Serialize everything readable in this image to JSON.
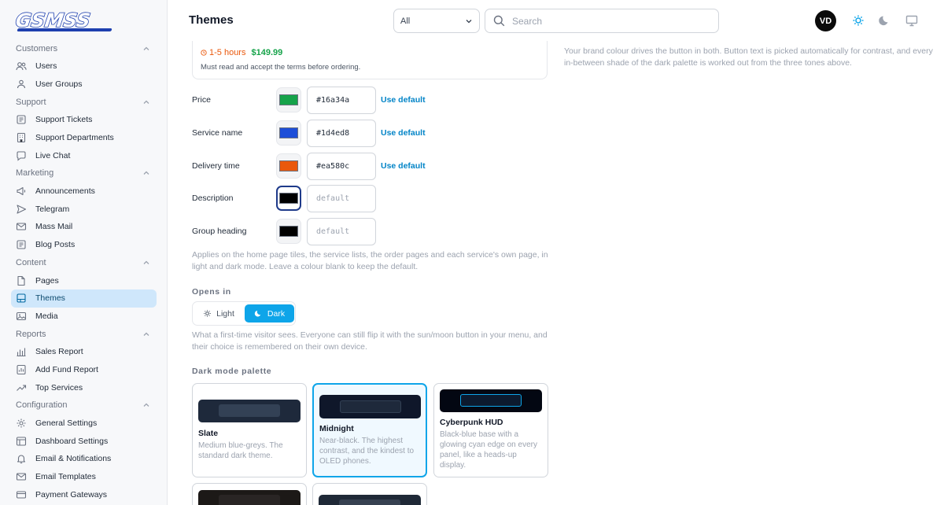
{
  "brand": {
    "logo_text": "GSMSS"
  },
  "header": {
    "title": "Themes",
    "filter_value": "All",
    "search_placeholder": "Search",
    "avatar_initials": "VD"
  },
  "sidebar": {
    "sections": [
      {
        "label": "Customers",
        "items": [
          {
            "label": "Users",
            "icon": "users-icon"
          },
          {
            "label": "User Groups",
            "icon": "user-group-icon"
          }
        ]
      },
      {
        "label": "Support",
        "items": [
          {
            "label": "Support Tickets",
            "icon": "ticket-icon"
          },
          {
            "label": "Support Departments",
            "icon": "building-icon"
          },
          {
            "label": "Live Chat",
            "icon": "chat-icon"
          }
        ]
      },
      {
        "label": "Marketing",
        "items": [
          {
            "label": "Announcements",
            "icon": "megaphone-icon"
          },
          {
            "label": "Telegram",
            "icon": "send-icon"
          },
          {
            "label": "Mass Mail",
            "icon": "mail-icon"
          },
          {
            "label": "Blog Posts",
            "icon": "blog-icon"
          }
        ]
      },
      {
        "label": "Content",
        "items": [
          {
            "label": "Pages",
            "icon": "page-icon"
          },
          {
            "label": "Themes",
            "icon": "brush-icon",
            "active": true
          },
          {
            "label": "Media",
            "icon": "image-icon"
          }
        ]
      },
      {
        "label": "Reports",
        "items": [
          {
            "label": "Sales Report",
            "icon": "bar-chart-icon"
          },
          {
            "label": "Add Fund Report",
            "icon": "report-icon"
          },
          {
            "label": "Top Services",
            "icon": "trend-icon"
          }
        ]
      },
      {
        "label": "Configuration",
        "items": [
          {
            "label": "General Settings",
            "icon": "gear-icon"
          },
          {
            "label": "Dashboard Settings",
            "icon": "dashboard-icon"
          },
          {
            "label": "Email & Notifications",
            "icon": "bell-icon"
          },
          {
            "label": "Email Templates",
            "icon": "template-icon"
          },
          {
            "label": "Payment Gateways",
            "icon": "card-icon"
          }
        ]
      }
    ]
  },
  "preview_card": {
    "delivery_time": "1-5 hours",
    "price": "$149.99",
    "note": "Must read and accept the terms before ordering."
  },
  "colors": {
    "use_default_label": "Use default",
    "rows": [
      {
        "label": "Price",
        "value": "#16a34a",
        "swatch": "#16a34a"
      },
      {
        "label": "Service name",
        "value": "#1d4ed8",
        "swatch": "#1d4ed8"
      },
      {
        "label": "Delivery time",
        "value": "#ea580c",
        "swatch": "#ea580c"
      },
      {
        "label": "Description",
        "value": "",
        "placeholder": "default",
        "swatch": "#000000"
      },
      {
        "label": "Group heading",
        "value": "",
        "placeholder": "default",
        "swatch": "#000000"
      }
    ],
    "help": "Applies on the home page tiles, the service lists, the order pages and each service's own page, in light and dark mode. Leave a colour blank to keep the default."
  },
  "opens_in": {
    "label": "Opens in",
    "light_label": "Light",
    "dark_label": "Dark",
    "selected": "Dark",
    "help": "What a first-time visitor sees. Everyone can still flip it with the sun/moon button in your menu, and their choice is remembered on their own device."
  },
  "dark_palette": {
    "label": "Dark mode palette",
    "options": [
      {
        "name": "Slate",
        "description": "Medium blue-greys. The standard dark theme.",
        "bg": "#1e293b",
        "inner": "#334155"
      },
      {
        "name": "Midnight",
        "description": "Near-black. The highest contrast, and the kindest to OLED phones.",
        "bg": "#0f172a",
        "inner": "#1e293b",
        "selected": true
      },
      {
        "name": "Cyberpunk HUD",
        "description": "Black-blue base with a glowing cyan edge on every panel, like a heads-up display.",
        "bg": "#030712",
        "inner": "#0c1a2e"
      }
    ]
  },
  "side_help": "Your brand colour drives the button in both. Button text is picked automatically for contrast, and every in-between shade of the dark palette is worked out from the three tones above."
}
